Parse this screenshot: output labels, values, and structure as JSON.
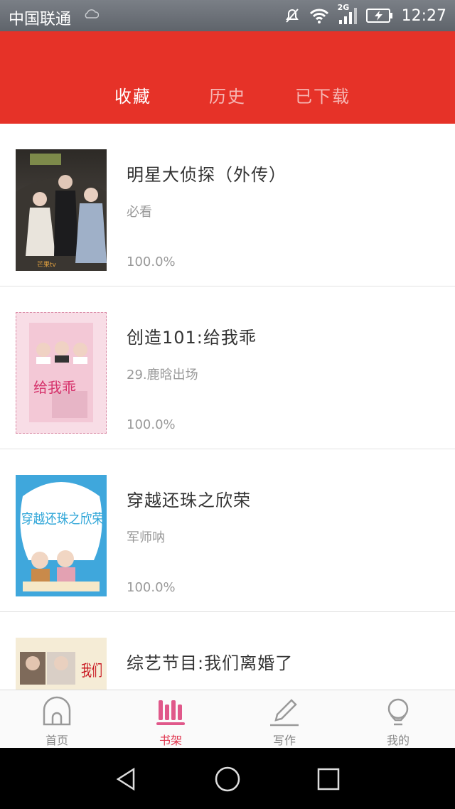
{
  "status_bar": {
    "carrier": "中国联通",
    "network": "2G",
    "time": "12:27"
  },
  "tabs": [
    {
      "label": "收藏",
      "active": true
    },
    {
      "label": "历史",
      "active": false
    },
    {
      "label": "已下载",
      "active": false
    }
  ],
  "books": [
    {
      "title": "明星大侦探（外传）",
      "author": "必看",
      "progress": "100.0%",
      "cover_icon": "detective-cover"
    },
    {
      "title": "创造101:给我乖",
      "author": "29.鹿晗出场",
      "progress": "100.0%",
      "cover_icon": "pink-cover",
      "cover_text": "给我乖"
    },
    {
      "title": "穿越还珠之欣荣",
      "author": "军师呐",
      "progress": "100.0%",
      "cover_icon": "blue-cover",
      "cover_text": "穿越还珠之欣荣"
    },
    {
      "title": "综艺节目:我们离婚了",
      "author": "",
      "progress": "",
      "cover_icon": "variety-cover",
      "cover_text": "我们"
    }
  ],
  "bottom_nav": [
    {
      "label": "首页",
      "icon": "home-icon",
      "active": false
    },
    {
      "label": "书架",
      "icon": "bookshelf-icon",
      "active": true
    },
    {
      "label": "写作",
      "icon": "pencil-icon",
      "active": false
    },
    {
      "label": "我的",
      "icon": "profile-icon",
      "active": false
    }
  ],
  "colors": {
    "header_red": "#e63228",
    "active_pink": "#e0344e"
  }
}
